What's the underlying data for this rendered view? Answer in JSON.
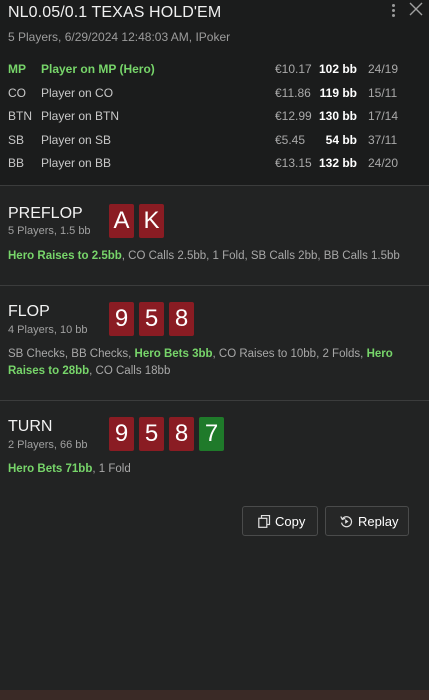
{
  "header": {
    "title": "NL0.05/0.1 TEXAS HOLD'EM",
    "subtitle": "5 Players, 6/29/2024 12:48:03 AM, IPoker"
  },
  "players": [
    {
      "position": "MP",
      "name": "Player on MP (Hero)",
      "money": "€10.17",
      "bb": "102 bb",
      "ratio": "24/19",
      "hero": true
    },
    {
      "position": "CO",
      "name": "Player on CO",
      "money": "€11.86",
      "bb": "119 bb",
      "ratio": "15/11",
      "hero": false
    },
    {
      "position": "BTN",
      "name": "Player on BTN",
      "money": "€12.99",
      "bb": "130 bb",
      "ratio": "17/14",
      "hero": false
    },
    {
      "position": "SB",
      "name": "Player on SB",
      "money": "€5.45",
      "bb": "54 bb",
      "ratio": "37/11",
      "hero": false
    },
    {
      "position": "BB",
      "name": "Player on BB",
      "money": "€13.15",
      "bb": "132 bb",
      "ratio": "24/20",
      "hero": false
    }
  ],
  "streets": {
    "preflop": {
      "name": "PREFLOP",
      "info": "5 Players, 1.5 bb",
      "cards": [
        {
          "rank": "A",
          "color": "red"
        },
        {
          "rank": "K",
          "color": "red"
        }
      ],
      "actions": [
        {
          "text": "Hero Raises to 2.5bb",
          "hero": true
        },
        {
          "text": ", CO Calls 2.5bb, 1 Fold, SB Calls 2bb, BB Calls 1.5bb",
          "hero": false
        }
      ]
    },
    "flop": {
      "name": "FLOP",
      "info": "4 Players, 10 bb",
      "cards": [
        {
          "rank": "9",
          "color": "red"
        },
        {
          "rank": "5",
          "color": "red"
        },
        {
          "rank": "8",
          "color": "red"
        }
      ],
      "actions": [
        {
          "text": "SB Checks, BB Checks, ",
          "hero": false
        },
        {
          "text": "Hero Bets 3bb",
          "hero": true
        },
        {
          "text": ", CO Raises to 10bb, 2 Folds, ",
          "hero": false
        },
        {
          "text": "Hero Raises to 28bb",
          "hero": true
        },
        {
          "text": ", CO Calls 18bb",
          "hero": false
        }
      ]
    },
    "turn": {
      "name": "TURN",
      "info": "2 Players, 66 bb",
      "cards": [
        {
          "rank": "9",
          "color": "red"
        },
        {
          "rank": "5",
          "color": "red"
        },
        {
          "rank": "8",
          "color": "red"
        },
        {
          "rank": "7",
          "color": "green"
        }
      ],
      "actions": [
        {
          "text": "Hero Bets 71bb",
          "hero": true
        },
        {
          "text": ", 1 Fold",
          "hero": false
        }
      ]
    }
  },
  "buttons": {
    "copy": {
      "label": "Copy",
      "icon": "copy-icon"
    },
    "replay": {
      "label": "Replay",
      "icon": "replay-icon"
    }
  },
  "colors": {
    "hero": "#77d56a",
    "card_red": "#8a1c23",
    "card_green": "#1f7a2a"
  }
}
